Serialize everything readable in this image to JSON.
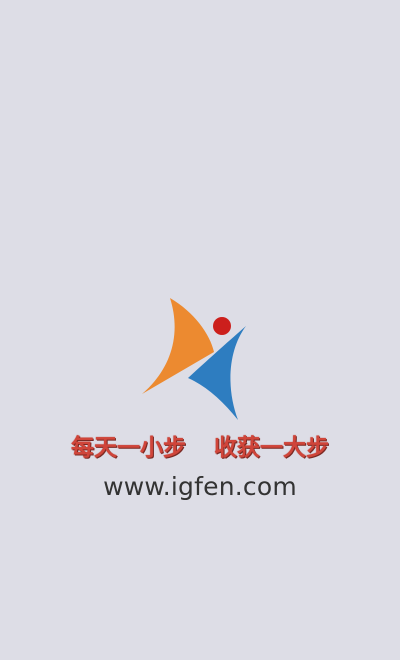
{
  "splash": {
    "background": "#dddde6",
    "logo": {
      "icon": "igfen-logo-icon",
      "colors": {
        "orange": "#ec8a30",
        "blue": "#2e7dc0",
        "red": "#cc1f1c"
      }
    },
    "slogan": {
      "part1": "每天一小步",
      "part2": "收获一大步",
      "color": "#d0453a"
    },
    "website": "www.igfen.com"
  }
}
